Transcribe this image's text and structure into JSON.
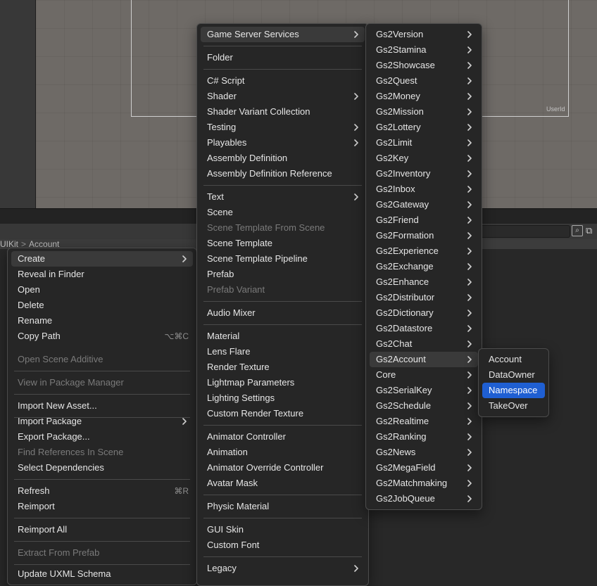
{
  "scene": {
    "userid_label": "UserId"
  },
  "breadcrumb": [
    "UIKit",
    "Account"
  ],
  "context_menu": {
    "items": [
      {
        "label": "Create",
        "submenu": true,
        "highlighted": true
      },
      {
        "label": "Reveal in Finder"
      },
      {
        "label": "Open"
      },
      {
        "label": "Delete"
      },
      {
        "label": "Rename"
      },
      {
        "label": "Copy Path",
        "shortcut": "⌥⌘C"
      },
      {
        "label": "Open Scene Additive",
        "disabled": true
      },
      {
        "label": "View in Package Manager",
        "disabled": true
      },
      {
        "label": "Import New Asset..."
      },
      {
        "label": "Import Package",
        "submenu": true
      },
      {
        "label": "Export Package..."
      },
      {
        "label": "Find References In Scene",
        "disabled": true
      },
      {
        "label": "Select Dependencies"
      },
      {
        "label": "Refresh",
        "shortcut": "⌘R"
      },
      {
        "label": "Reimport"
      },
      {
        "label": "Reimport All"
      },
      {
        "label": "Extract From Prefab",
        "disabled": true
      },
      {
        "label": "Update UXML Schema"
      }
    ]
  },
  "create_menu": {
    "items": [
      {
        "label": "Game Server Services",
        "submenu": true,
        "highlighted": true
      },
      {
        "label": "Folder"
      },
      {
        "label": "C# Script"
      },
      {
        "label": "Shader",
        "submenu": true
      },
      {
        "label": "Shader Variant Collection"
      },
      {
        "label": "Testing",
        "submenu": true
      },
      {
        "label": "Playables",
        "submenu": true
      },
      {
        "label": "Assembly Definition"
      },
      {
        "label": "Assembly Definition Reference"
      },
      {
        "label": "Text",
        "submenu": true
      },
      {
        "label": "Scene"
      },
      {
        "label": "Scene Template From Scene",
        "disabled": true
      },
      {
        "label": "Scene Template"
      },
      {
        "label": "Scene Template Pipeline"
      },
      {
        "label": "Prefab"
      },
      {
        "label": "Prefab Variant",
        "disabled": true
      },
      {
        "label": "Audio Mixer"
      },
      {
        "label": "Material"
      },
      {
        "label": "Lens Flare"
      },
      {
        "label": "Render Texture"
      },
      {
        "label": "Lightmap Parameters"
      },
      {
        "label": "Lighting Settings"
      },
      {
        "label": "Custom Render Texture"
      },
      {
        "label": "Animator Controller"
      },
      {
        "label": "Animation"
      },
      {
        "label": "Animator Override Controller"
      },
      {
        "label": "Avatar Mask"
      },
      {
        "label": "Physic Material"
      },
      {
        "label": "GUI Skin"
      },
      {
        "label": "Custom Font"
      },
      {
        "label": "Legacy",
        "submenu": true
      }
    ]
  },
  "gs2_menu": {
    "items": [
      {
        "label": "Gs2Version"
      },
      {
        "label": "Gs2Stamina"
      },
      {
        "label": "Gs2Showcase"
      },
      {
        "label": "Gs2Quest"
      },
      {
        "label": "Gs2Money"
      },
      {
        "label": "Gs2Mission"
      },
      {
        "label": "Gs2Lottery"
      },
      {
        "label": "Gs2Limit"
      },
      {
        "label": "Gs2Key"
      },
      {
        "label": "Gs2Inventory"
      },
      {
        "label": "Gs2Inbox"
      },
      {
        "label": "Gs2Gateway"
      },
      {
        "label": "Gs2Friend"
      },
      {
        "label": "Gs2Formation"
      },
      {
        "label": "Gs2Experience"
      },
      {
        "label": "Gs2Exchange"
      },
      {
        "label": "Gs2Enhance"
      },
      {
        "label": "Gs2Distributor"
      },
      {
        "label": "Gs2Dictionary"
      },
      {
        "label": "Gs2Datastore"
      },
      {
        "label": "Gs2Chat"
      },
      {
        "label": "Gs2Account",
        "highlighted": true
      },
      {
        "label": "Core"
      },
      {
        "label": "Gs2SerialKey"
      },
      {
        "label": "Gs2Schedule"
      },
      {
        "label": "Gs2Realtime"
      },
      {
        "label": "Gs2Ranking"
      },
      {
        "label": "Gs2News"
      },
      {
        "label": "Gs2MegaField"
      },
      {
        "label": "Gs2Matchmaking"
      },
      {
        "label": "Gs2JobQueue"
      }
    ]
  },
  "account_menu": {
    "items": [
      {
        "label": "Account"
      },
      {
        "label": "DataOwner"
      },
      {
        "label": "Namespace",
        "selected": true
      },
      {
        "label": "TakeOver"
      }
    ]
  },
  "colors": {
    "selection": "#1f5fd2",
    "menu_bg": "#262626",
    "highlight": "#3a3a3a"
  }
}
